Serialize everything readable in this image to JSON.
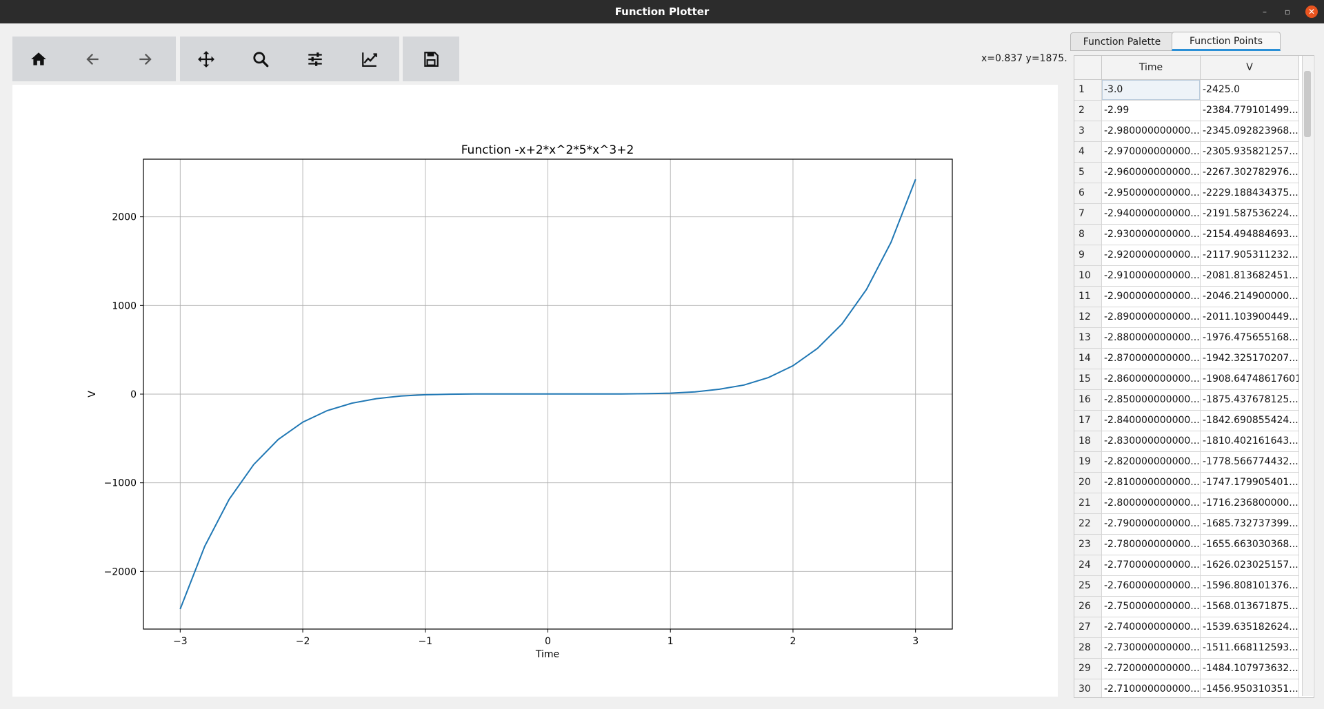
{
  "window": {
    "title": "Function Plotter",
    "controls": {
      "minimize": "–",
      "maximize": "▫",
      "close": "✕"
    }
  },
  "toolbar": {
    "buttons": [
      {
        "name": "home",
        "icon": "home-icon"
      },
      {
        "name": "back",
        "icon": "arrow-left-icon"
      },
      {
        "name": "forward",
        "icon": "arrow-right-icon"
      },
      {
        "name": "pan",
        "icon": "move-icon"
      },
      {
        "name": "zoom",
        "icon": "search-icon"
      },
      {
        "name": "configure-subplots",
        "icon": "sliders-icon"
      },
      {
        "name": "edit-axes",
        "icon": "line-chart-icon"
      },
      {
        "name": "save",
        "icon": "floppy-disk-icon"
      }
    ]
  },
  "status": {
    "coordinates": "x=0.837 y=1875."
  },
  "chart_data": {
    "type": "line",
    "title": "Function -x+2*x^2*5*x^3+2",
    "xlabel": "Time",
    "ylabel": "V",
    "xlim": [
      -3.3,
      3.3
    ],
    "ylim": [
      -2650,
      2650
    ],
    "xticks": [
      -3,
      -2,
      -1,
      0,
      1,
      2,
      3
    ],
    "xtick_labels": [
      "−3",
      "−2",
      "−1",
      "0",
      "1",
      "2",
      "3"
    ],
    "yticks": [
      -2000,
      -1000,
      0,
      1000,
      2000
    ],
    "ytick_labels": [
      "−2000",
      "−1000",
      "0",
      "1000",
      "2000"
    ],
    "grid": true,
    "line_color": "#1f77b4",
    "series": [
      {
        "x": [
          -3.0,
          -2.8,
          -2.6,
          -2.4,
          -2.2,
          -2.0,
          -1.8,
          -1.6,
          -1.4,
          -1.2,
          -1.0,
          -0.8,
          -0.6,
          -0.4,
          -0.2,
          0.0,
          0.2,
          0.4,
          0.6,
          0.8,
          1.0,
          1.2,
          1.4,
          1.6,
          1.8,
          2.0,
          2.2,
          2.4,
          2.6,
          2.8,
          3.0
        ],
        "values": [
          -2425.0,
          -1716.2,
          -1185.4,
          -793.1,
          -511.2,
          -316.0,
          -186.1,
          -102.8,
          -51.0,
          -21.7,
          -7.0,
          -0.5,
          1.8,
          2.3,
          2.2,
          2.0,
          1.8,
          1.7,
          2.2,
          4.5,
          11.0,
          25.7,
          55.4,
          102.9,
          187.1,
          320.0,
          516.0,
          791.4,
          1181.5,
          1712.3,
          2423.0
        ]
      }
    ]
  },
  "tabs": [
    {
      "label": "Function Palette",
      "active": false
    },
    {
      "label": "Function Points",
      "active": true
    }
  ],
  "table": {
    "columns": [
      "Time",
      "V"
    ],
    "rows": [
      {
        "idx": "1",
        "time": "-3.0",
        "v": "-2425.0"
      },
      {
        "idx": "2",
        "time": "-2.99",
        "v": "-2384.779101499..."
      },
      {
        "idx": "3",
        "time": "-2.980000000000...",
        "v": "-2345.092823968..."
      },
      {
        "idx": "4",
        "time": "-2.970000000000...",
        "v": "-2305.935821257..."
      },
      {
        "idx": "5",
        "time": "-2.960000000000...",
        "v": "-2267.302782976..."
      },
      {
        "idx": "6",
        "time": "-2.950000000000...",
        "v": "-2229.188434375..."
      },
      {
        "idx": "7",
        "time": "-2.940000000000...",
        "v": "-2191.587536224..."
      },
      {
        "idx": "8",
        "time": "-2.930000000000...",
        "v": "-2154.494884693..."
      },
      {
        "idx": "9",
        "time": "-2.920000000000...",
        "v": "-2117.905311232..."
      },
      {
        "idx": "10",
        "time": "-2.910000000000...",
        "v": "-2081.813682451..."
      },
      {
        "idx": "11",
        "time": "-2.900000000000...",
        "v": "-2046.214900000..."
      },
      {
        "idx": "12",
        "time": "-2.890000000000...",
        "v": "-2011.103900449..."
      },
      {
        "idx": "13",
        "time": "-2.880000000000...",
        "v": "-1976.475655168..."
      },
      {
        "idx": "14",
        "time": "-2.870000000000...",
        "v": "-1942.325170207..."
      },
      {
        "idx": "15",
        "time": "-2.860000000000...",
        "v": "-1908.64748617601"
      },
      {
        "idx": "16",
        "time": "-2.850000000000...",
        "v": "-1875.437678125..."
      },
      {
        "idx": "17",
        "time": "-2.840000000000...",
        "v": "-1842.690855424..."
      },
      {
        "idx": "18",
        "time": "-2.830000000000...",
        "v": "-1810.402161643..."
      },
      {
        "idx": "19",
        "time": "-2.820000000000...",
        "v": "-1778.566774432..."
      },
      {
        "idx": "20",
        "time": "-2.810000000000...",
        "v": "-1747.179905401..."
      },
      {
        "idx": "21",
        "time": "-2.800000000000...",
        "v": "-1716.236800000..."
      },
      {
        "idx": "22",
        "time": "-2.790000000000...",
        "v": "-1685.732737399..."
      },
      {
        "idx": "23",
        "time": "-2.780000000000...",
        "v": "-1655.663030368..."
      },
      {
        "idx": "24",
        "time": "-2.770000000000...",
        "v": "-1626.023025157..."
      },
      {
        "idx": "25",
        "time": "-2.760000000000...",
        "v": "-1596.808101376..."
      },
      {
        "idx": "26",
        "time": "-2.750000000000...",
        "v": "-1568.013671875..."
      },
      {
        "idx": "27",
        "time": "-2.740000000000...",
        "v": "-1539.635182624..."
      },
      {
        "idx": "28",
        "time": "-2.730000000000...",
        "v": "-1511.668112593..."
      },
      {
        "idx": "29",
        "time": "-2.720000000000...",
        "v": "-1484.107973632..."
      },
      {
        "idx": "30",
        "time": "-2.710000000000...",
        "v": "-1456.950310351..."
      }
    ]
  }
}
